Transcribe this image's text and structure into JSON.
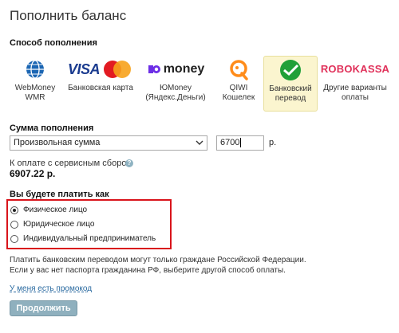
{
  "page": {
    "title": "Пополнить баланс"
  },
  "method_section": {
    "label": "Способ пополнения"
  },
  "methods": [
    {
      "logo_text": "",
      "label": "WebMoney WMR",
      "selected": false
    },
    {
      "logo_text": "VISA",
      "logo_badge": "MasterCard",
      "label": "Банковская карта",
      "selected": false
    },
    {
      "logo_text": "money",
      "logo_prefix": "Ю",
      "label": "ЮMoney (Яндекс.Деньги)",
      "selected": false
    },
    {
      "logo_text": "",
      "label": "QIWI Кошелек",
      "selected": false
    },
    {
      "logo_text": "",
      "label": "Банковский перевод",
      "selected": true
    },
    {
      "logo_text": "ROBOKASSA",
      "label": "Другие варианты оплаты",
      "selected": false
    }
  ],
  "amount_section": {
    "label": "Сумма пополнения",
    "select_value": "Произвольная сумма",
    "amount_value": "6700",
    "unit": "р."
  },
  "service_fee": {
    "label": "К оплате с сервисным сбором",
    "total": "6907.22 р."
  },
  "payer_section": {
    "label": "Вы будете платить как",
    "options": [
      {
        "label": "Физическое лицо",
        "checked": true
      },
      {
        "label": "Юридическое лицо",
        "checked": false
      },
      {
        "label": "Индивидуальный предприниматель",
        "checked": false
      }
    ]
  },
  "note": {
    "line1": "Платить банковским переводом могут только граждане Российской Федерации.",
    "line2": "Если у вас нет паспорта гражданина РФ, выберите другой способ оплаты."
  },
  "promo_link": "У меня есть промокод",
  "submit_button": "Продолжить",
  "colors": {
    "highlight_border": "#d9141b",
    "selected_bg": "#fbf5cf",
    "button_bg": "#8fb0be",
    "link": "#2a6aa0"
  }
}
